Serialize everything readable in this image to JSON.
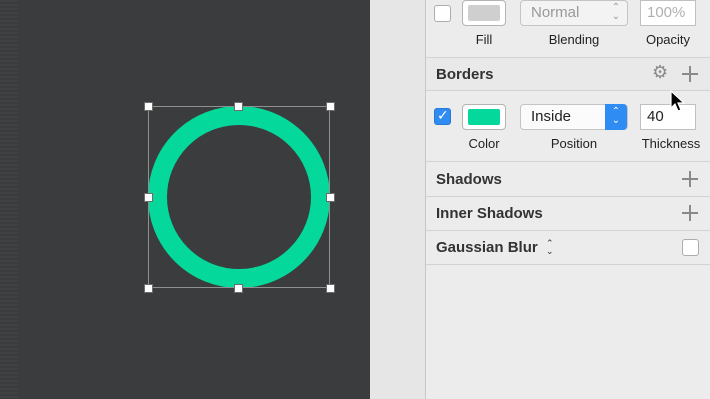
{
  "fill": {
    "blending_value": "Normal",
    "opacity_value": "100%",
    "fill_label": "Fill",
    "blending_label": "Blending",
    "opacity_label": "Opacity",
    "enabled": false
  },
  "borders": {
    "title": "Borders",
    "enabled": true,
    "color": "#04d89a",
    "position_value": "Inside",
    "thickness_value": "40",
    "color_label": "Color",
    "position_label": "Position",
    "thickness_label": "Thickness"
  },
  "shadows": {
    "title": "Shadows"
  },
  "inner_shadows": {
    "title": "Inner Shadows"
  },
  "gaussian_blur": {
    "title": "Gaussian Blur",
    "enabled": false
  },
  "canvas": {
    "shape": "circle",
    "stroke_color": "#04d89a",
    "background": "#3a3c3d"
  },
  "icons": {
    "add": "plus-icon",
    "settings": "gear-icon",
    "stepper": "updown-chevron-icon"
  }
}
